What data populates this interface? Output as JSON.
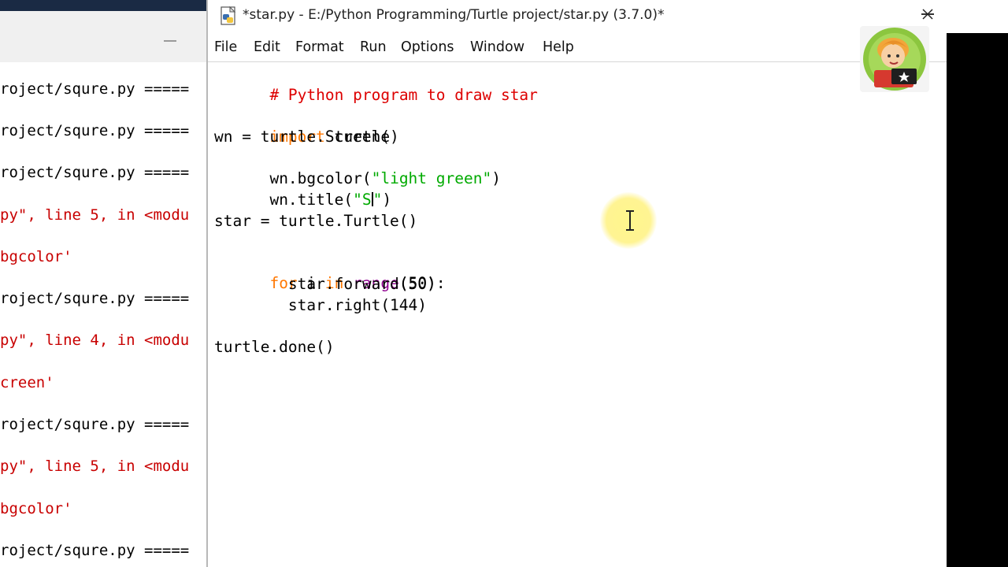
{
  "shell": {
    "lines": [
      {
        "text": "roject/squre.py =====",
        "color": "black"
      },
      {
        "text": "roject/squre.py =====",
        "color": "black"
      },
      {
        "text": "roject/squre.py =====",
        "color": "black"
      },
      {
        "text": "py\", line 5, in <modu",
        "color": "red"
      },
      {
        "text": "bgcolor'",
        "color": "red"
      },
      {
        "text": "roject/squre.py =====",
        "color": "black"
      },
      {
        "text": "py\", line 4, in <modu",
        "color": "red"
      },
      {
        "text": "creen'",
        "color": "red"
      },
      {
        "text": "roject/squre.py =====",
        "color": "black"
      },
      {
        "text": "py\", line 5, in <modu",
        "color": "red"
      },
      {
        "text": "bgcolor'",
        "color": "red"
      },
      {
        "text": "roject/squre.py =====",
        "color": "black"
      }
    ]
  },
  "editor": {
    "title": "*star.py - E:/Python Programming/Turtle project/star.py (3.7.0)*",
    "icon": "python-file-icon"
  },
  "menu": {
    "file": "File",
    "edit": "Edit",
    "format": "Format",
    "run": "Run",
    "options": "Options",
    "window": "Window",
    "help": "Help"
  },
  "code": {
    "comment": "# Python program to draw star",
    "import_kw": "import",
    "import_rest": " turtle",
    "line_screen": "wn = turtle.Screen()",
    "bg_pre": "wn.bgcolor(",
    "bg_str": "\"light green\"",
    "bg_post": ")",
    "title_pre": "wn.title(",
    "title_str_open": "\"S",
    "title_str_close": "\"",
    "title_post": ")",
    "line_star": "star = turtle.Turtle()",
    "for_kw": "for",
    "for_mid1": " i ",
    "in_kw": "in",
    "for_mid2": " ",
    "range_builtin": "range",
    "for_rest": "(50):",
    "line_forward": "        star.forward(50)",
    "line_right": "        star.right(144)",
    "line_done": "turtle.done()"
  },
  "colors": {
    "keyword": "#ff7700",
    "string": "#00aa00",
    "comment": "#dd0000",
    "builtin": "#900090",
    "shell_error": "#c80000"
  },
  "avatar_icon": "channel-avatar-icon"
}
